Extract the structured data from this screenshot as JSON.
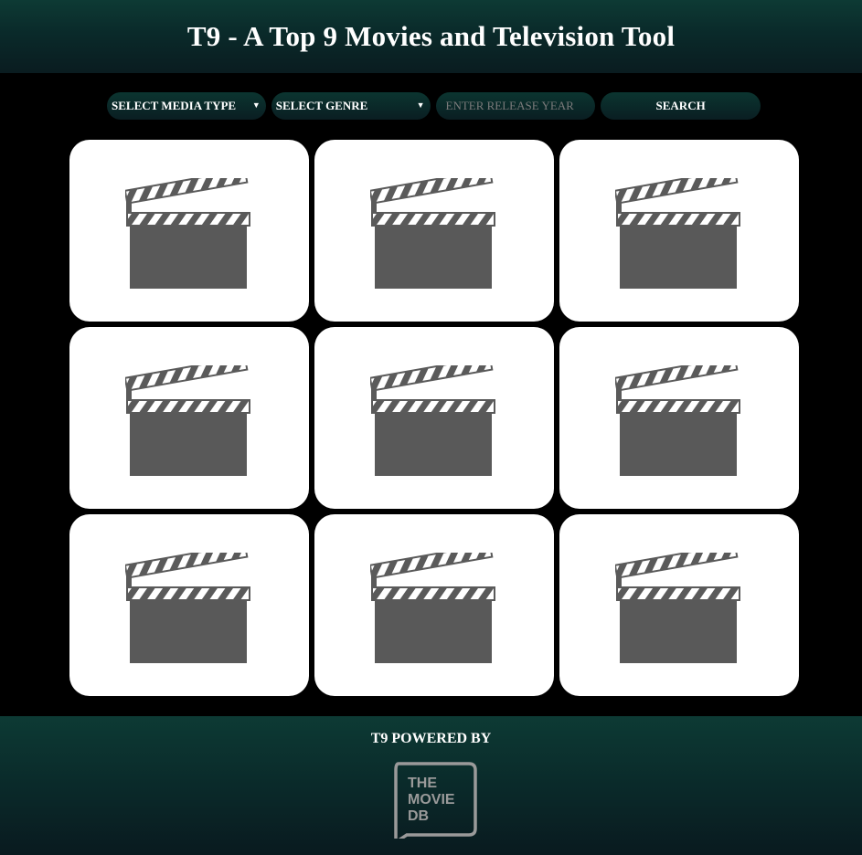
{
  "header": {
    "title": "T9 - A Top 9 Movies and Television Tool"
  },
  "controls": {
    "media_type_label": "SELECT MEDIA TYPE",
    "genre_label": "SELECT GENRE",
    "year_placeholder": "ENTER RELEASE YEAR",
    "year_value": "",
    "search_label": "SEARCH"
  },
  "results": {
    "cards": [
      {
        "image": "clapperboard-placeholder"
      },
      {
        "image": "clapperboard-placeholder"
      },
      {
        "image": "clapperboard-placeholder"
      },
      {
        "image": "clapperboard-placeholder"
      },
      {
        "image": "clapperboard-placeholder"
      },
      {
        "image": "clapperboard-placeholder"
      },
      {
        "image": "clapperboard-placeholder"
      },
      {
        "image": "clapperboard-placeholder"
      },
      {
        "image": "clapperboard-placeholder"
      }
    ]
  },
  "footer": {
    "powered_by": "T9 POWERED BY",
    "logo_lines": [
      "THE",
      "MOVIE",
      "DB"
    ]
  },
  "colors": {
    "header_bg": "#0d3a34",
    "page_bg": "#000000",
    "card_bg": "#ffffff",
    "clapper": "#595959"
  }
}
